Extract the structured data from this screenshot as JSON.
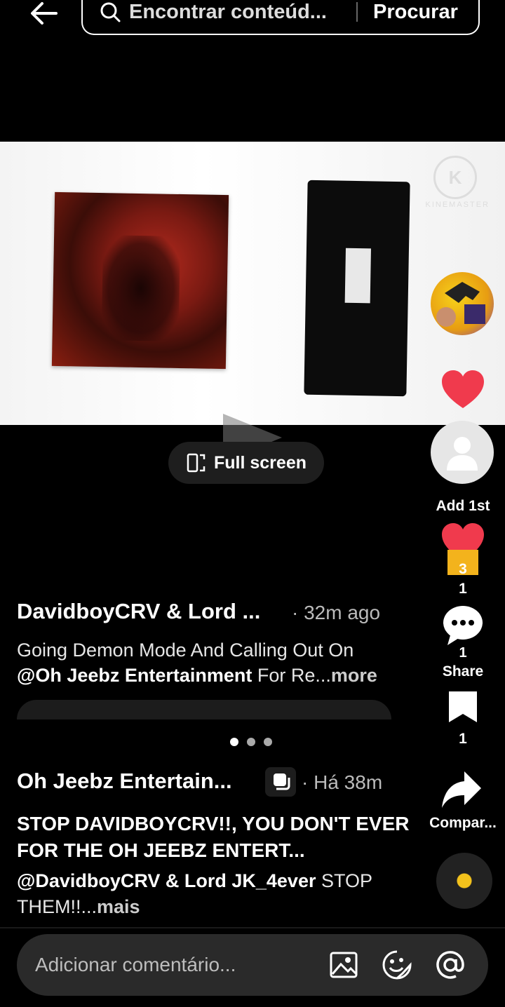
{
  "top": {
    "search_text": "Encontrar conteúd...",
    "search_button": "Procurar"
  },
  "video": {
    "watermark": "KINEMASTER",
    "fullscreen_label": "Full screen"
  },
  "rail": {
    "add_first_label": "Add 1st",
    "like_count_top": "3",
    "like_count": "1",
    "comment_count": "1",
    "share_label": "Share",
    "bookmark_count": "1",
    "share_label_pt": "Compar..."
  },
  "post1": {
    "author": "DavidboyCRV & Lord ...",
    "time": "· 32m ago",
    "line1": "Going Demon Mode And Calling Out On",
    "mention": "@Oh Jeebz Entertainment",
    "line2_rest": " For Re...",
    "more": "more"
  },
  "post2": {
    "author": "Oh Jeebz Entertain...",
    "time": "· Há 38m",
    "title": "STOP DAVIDBOYCRV!!, YOU DON'T EVER FOR THE OH JEEBZ ENTERT...",
    "mention": "@DavidboyCRV & Lord JK_4ever",
    "desc_rest": " STOP THEM!!...",
    "more": "mais"
  },
  "comment_bar": {
    "placeholder": "Adicionar comentário..."
  },
  "colors": {
    "accent_red": "#fe2c55",
    "heart": "#f03a4d",
    "ribbon": "#f3b31c"
  }
}
